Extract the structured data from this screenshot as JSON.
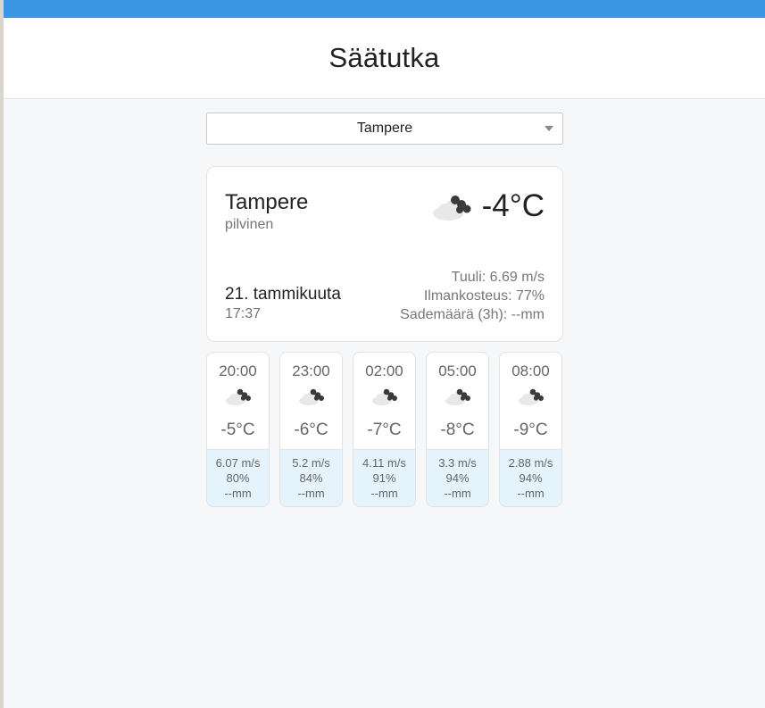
{
  "app": {
    "title": "Säätutka"
  },
  "colors": {
    "accent": "#3b97e5",
    "forecast_bg": "#e5f3fc"
  },
  "location_select": {
    "selected": "Tampere"
  },
  "current": {
    "city": "Tampere",
    "description": "pilvinen",
    "icon": "cloud-icon",
    "temperature": "-4°C",
    "date": "21. tammikuuta",
    "time": "17:37",
    "wind": "Tuuli: 6.69 m/s",
    "humidity": "Ilmankosteus: 77%",
    "precipitation": "Sademäärä (3h): --mm"
  },
  "forecast": [
    {
      "time": "20:00",
      "icon": "cloud-icon",
      "temp": "-5°C",
      "wind": "6.07 m/s",
      "humidity": "80%",
      "precip": "--mm"
    },
    {
      "time": "23:00",
      "icon": "cloud-icon",
      "temp": "-6°C",
      "wind": "5.2 m/s",
      "humidity": "84%",
      "precip": "--mm"
    },
    {
      "time": "02:00",
      "icon": "cloud-icon",
      "temp": "-7°C",
      "wind": "4.11 m/s",
      "humidity": "91%",
      "precip": "--mm"
    },
    {
      "time": "05:00",
      "icon": "cloud-icon",
      "temp": "-8°C",
      "wind": "3.3 m/s",
      "humidity": "94%",
      "precip": "--mm"
    },
    {
      "time": "08:00",
      "icon": "cloud-icon",
      "temp": "-9°C",
      "wind": "2.88 m/s",
      "humidity": "94%",
      "precip": "--mm"
    }
  ]
}
